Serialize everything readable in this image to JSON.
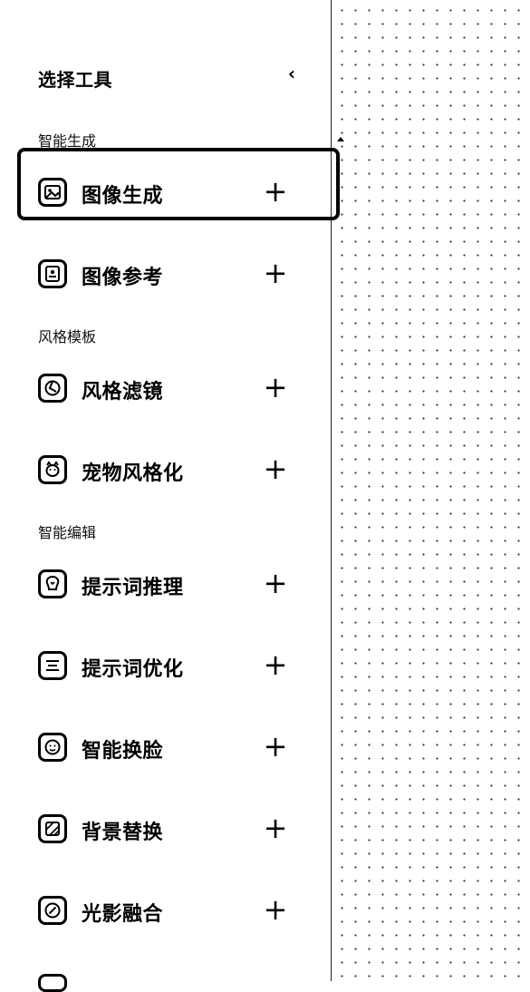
{
  "panel": {
    "title": "选择工具",
    "collapse_symbol": "‹"
  },
  "sections": [
    {
      "title": "智能生成",
      "items": [
        {
          "label": "图像生成",
          "icon": "image-generate-icon",
          "add": "+",
          "selected": true
        },
        {
          "label": "图像参考",
          "icon": "image-reference-icon",
          "add": "+"
        }
      ]
    },
    {
      "title": "风格模板",
      "items": [
        {
          "label": "风格滤镜",
          "icon": "style-filter-icon",
          "add": "+"
        },
        {
          "label": "宠物风格化",
          "icon": "pet-style-icon",
          "add": "+"
        }
      ]
    },
    {
      "title": "智能编辑",
      "items": [
        {
          "label": "提示词推理",
          "icon": "prompt-reasoning-icon",
          "add": "+"
        },
        {
          "label": "提示词优化",
          "icon": "prompt-optimize-icon",
          "add": "+"
        },
        {
          "label": "智能换脸",
          "icon": "face-swap-icon",
          "add": "+"
        },
        {
          "label": "背景替换",
          "icon": "background-replace-icon",
          "add": "+"
        },
        {
          "label": "光影融合",
          "icon": "light-blend-icon",
          "add": "+"
        }
      ]
    }
  ]
}
